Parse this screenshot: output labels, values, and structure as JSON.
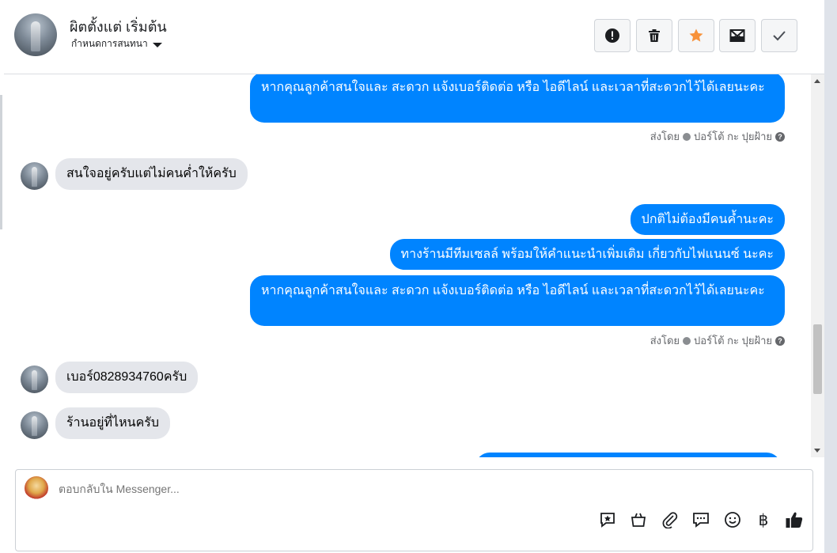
{
  "header": {
    "contact_name": "ผิตตั้งแต่ เริ่มต้น",
    "label_dropdown": "กำหนดการสนทนา",
    "actions": [
      "alert-icon",
      "trash-icon",
      "star-icon",
      "mark-unread-icon",
      "check-icon"
    ]
  },
  "colors": {
    "accent": "#0084ff",
    "incoming": "#e4e6eb",
    "star": "#f7923b"
  },
  "messages": {
    "out_1_top": "หากคุณลูกค้าสนใจและ สะดวก แจ้งเบอร์ติดต่อ หรือ ไอดีไลน์ และเวลาที่สะดวกไว้ได้เลยนะคะ",
    "sent_by_1": "ส่งโดย",
    "sender_1": "ปอร์โต้ กะ ปุยฝ้าย",
    "in_1": "สนใจอยู่ครับแต่ไม่คนค่ำให้ครับ",
    "out_2": "ปกติไม่ต้องมีคนค้ำนะคะ",
    "out_3": "ทางร้านมีทีมเซลล์ พร้อมให้คำแนะนำเพิ่มเติม เกี่ยวกับไฟแนนซ์ นะคะ",
    "out_4": "หากคุณลูกค้าสนใจและ สะดวก แจ้งเบอร์ติดต่อ หรือ ไอดีไลน์ และเวลาที่สะดวกไว้ได้เลยนะคะ",
    "sent_by_2": "ส่งโดย",
    "sender_2": "ปอร์โต้ กะ ปุยฝ้าย",
    "in_2": "เบอร์0828934760ครับ",
    "in_3": "ร้านอยู่ที่ไหนครับ"
  },
  "composer": {
    "placeholder": "ตอบกลับใน Messenger...",
    "tools": [
      "saved-reply-icon",
      "shop-icon",
      "attach-icon",
      "chat-bubbles-icon",
      "emoji-icon",
      "baht-icon",
      "like-icon"
    ],
    "baht_symbol": "฿"
  }
}
